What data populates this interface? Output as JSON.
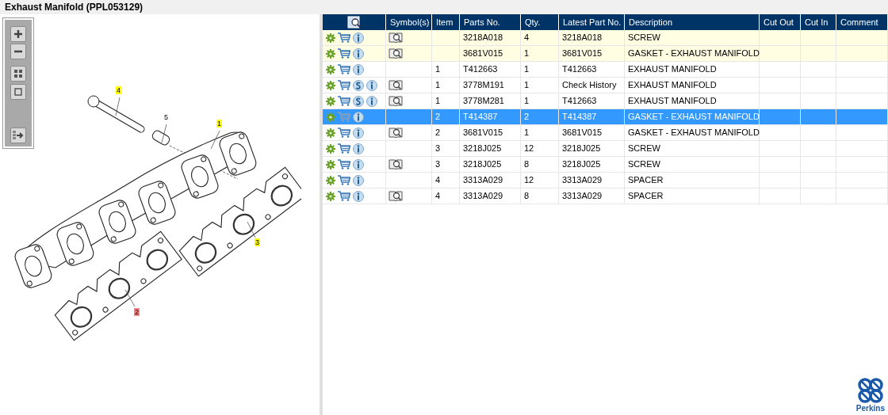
{
  "title": "Exhaust Manifold (PPL053129)",
  "toolbar": [
    {
      "kind": "zoom-in"
    },
    {
      "kind": "zoom-out"
    },
    {
      "kind": "fit"
    },
    {
      "kind": "actual-size"
    },
    {
      "kind": "export"
    }
  ],
  "callouts": [
    {
      "label": "4",
      "color": "#ffff00"
    },
    {
      "label": "5"
    },
    {
      "label": "1",
      "color": "#ffff00"
    },
    {
      "label": "3",
      "color": "#ffff00"
    },
    {
      "label": "2",
      "color": "#ff8080"
    }
  ],
  "table": {
    "columns": [
      "Symbol(s)",
      "Item",
      "Parts No.",
      "Qty.",
      "Latest Part No.",
      "Description",
      "Cut Out",
      "Cut In",
      "Comment"
    ],
    "rows": [
      {
        "service": false,
        "symbol": true,
        "item": "",
        "part": "3218A018",
        "qty": "4",
        "latest": "3218A018",
        "description": "SCREW",
        "highlighted": true,
        "selected": false
      },
      {
        "service": false,
        "symbol": true,
        "item": "",
        "part": "3681V015",
        "qty": "1",
        "latest": "3681V015",
        "description": "GASKET - EXHAUST MANIFOLD",
        "highlighted": true,
        "selected": false
      },
      {
        "service": false,
        "symbol": false,
        "item": "1",
        "part": "T412663",
        "qty": "1",
        "latest": "T412663",
        "description": "EXHAUST MANIFOLD",
        "highlighted": false,
        "selected": false
      },
      {
        "service": true,
        "symbol": true,
        "item": "1",
        "part": "3778M191",
        "qty": "1",
        "latest": "Check History",
        "description": "EXHAUST MANIFOLD",
        "highlighted": false,
        "selected": false
      },
      {
        "service": true,
        "symbol": true,
        "item": "1",
        "part": "3778M281",
        "qty": "1",
        "latest": "T412663",
        "description": "EXHAUST MANIFOLD",
        "highlighted": false,
        "selected": false
      },
      {
        "service": false,
        "symbol": false,
        "item": "2",
        "part": "T414387",
        "qty": "2",
        "latest": "T414387",
        "description": "GASKET - EXHAUST MANIFOLD",
        "highlighted": false,
        "selected": true
      },
      {
        "service": false,
        "symbol": true,
        "item": "2",
        "part": "3681V015",
        "qty": "1",
        "latest": "3681V015",
        "description": "GASKET - EXHAUST MANIFOLD",
        "highlighted": false,
        "selected": false
      },
      {
        "service": false,
        "symbol": false,
        "item": "3",
        "part": "3218J025",
        "qty": "12",
        "latest": "3218J025",
        "description": "SCREW",
        "highlighted": false,
        "selected": false
      },
      {
        "service": false,
        "symbol": true,
        "item": "3",
        "part": "3218J025",
        "qty": "8",
        "latest": "3218J025",
        "description": "SCREW",
        "highlighted": false,
        "selected": false
      },
      {
        "service": false,
        "symbol": false,
        "item": "4",
        "part": "3313A029",
        "qty": "12",
        "latest": "3313A029",
        "description": "SPACER",
        "highlighted": false,
        "selected": false
      },
      {
        "service": false,
        "symbol": true,
        "item": "4",
        "part": "3313A029",
        "qty": "8",
        "latest": "3313A029",
        "description": "SPACER",
        "highlighted": false,
        "selected": false
      }
    ]
  },
  "logo": {
    "name": "Perkins"
  }
}
